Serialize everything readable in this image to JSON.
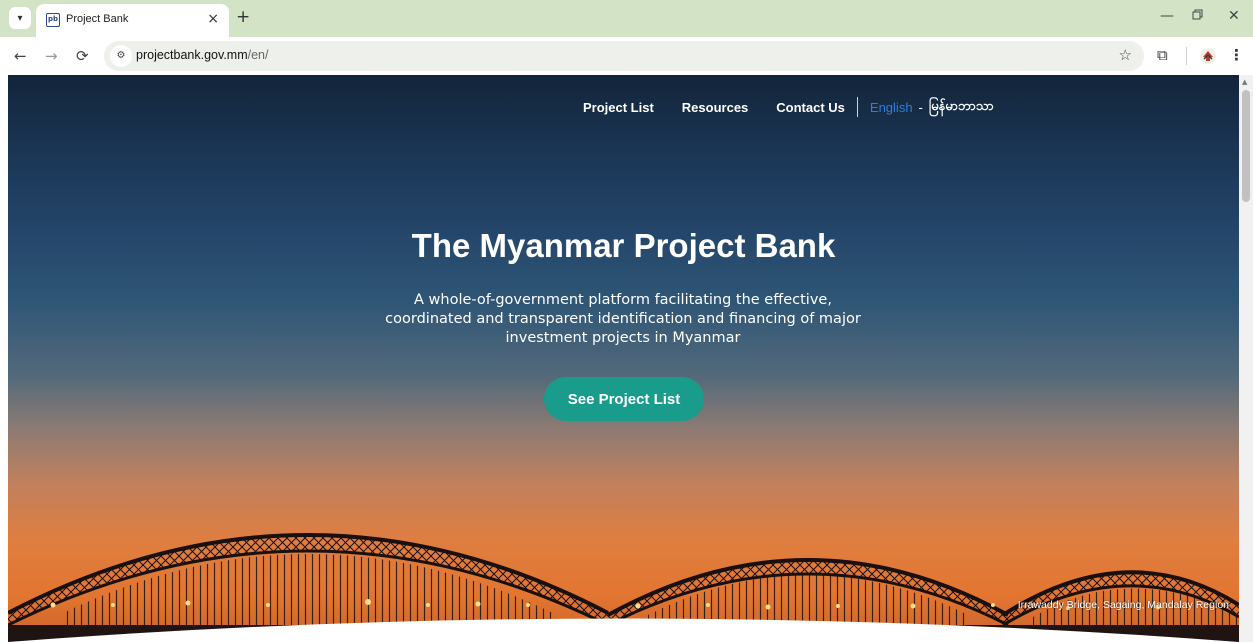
{
  "browser": {
    "tab_title": "Project Bank",
    "favicon_text": "pb",
    "close_glyph": "×",
    "new_tab_glyph": "+",
    "url_host": "projectbank.gov.mm",
    "url_path": "/en/",
    "icons": [
      "tab-search-icon",
      "back-icon",
      "forward-icon",
      "reload-icon",
      "site-info-icon",
      "star-icon",
      "extensions-icon",
      "profile-icon",
      "menu-icon",
      "minimize-icon",
      "restore-icon",
      "close-icon"
    ]
  },
  "nav": {
    "project_list": "Project List",
    "resources": "Resources",
    "contact_us": "Contact Us",
    "lang_en": "English",
    "lang_dash": "-",
    "lang_my": "မြန်မာဘာသာ"
  },
  "hero": {
    "title": "The Myanmar Project Bank",
    "subtitle": "A whole-of-government platform facilitating the effective, coordinated and transparent identification and financing of major investment projects in Myanmar",
    "cta_label": "See Project List",
    "caption": "Irrawaddy Bridge, Sagaing, Mandalay Region"
  },
  "colors": {
    "tabbar": "#d3e3c6",
    "cta": "#1a9c8c",
    "active_lang": "#2f7de0"
  }
}
